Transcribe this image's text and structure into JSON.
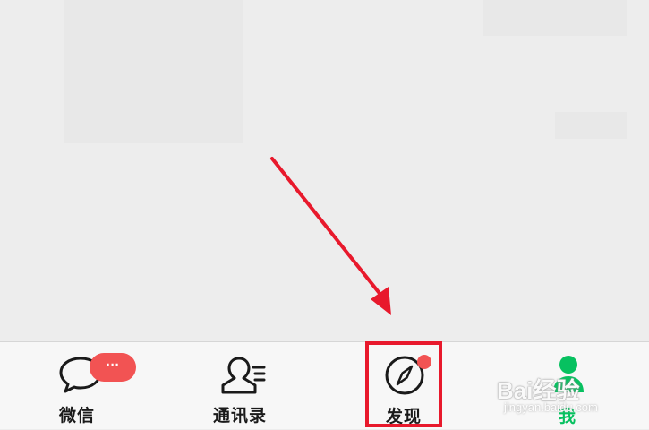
{
  "colors": {
    "accent_green": "#07c160",
    "badge_red": "#f25353",
    "annotation_red": "#e8192c",
    "tab_text": "#1a1a1a"
  },
  "tab_bar": {
    "tabs": [
      {
        "label": "微信",
        "icon": "chat-bubble-icon",
        "selected": false,
        "badge": "···"
      },
      {
        "label": "通讯录",
        "icon": "contacts-icon",
        "selected": false
      },
      {
        "label": "发现",
        "icon": "compass-icon",
        "selected": false,
        "red_dot": true
      },
      {
        "label": "我",
        "icon": "person-icon",
        "selected": true
      }
    ]
  },
  "watermark": {
    "brand": "Bai经验",
    "url": "jingyan.baidu.com"
  }
}
